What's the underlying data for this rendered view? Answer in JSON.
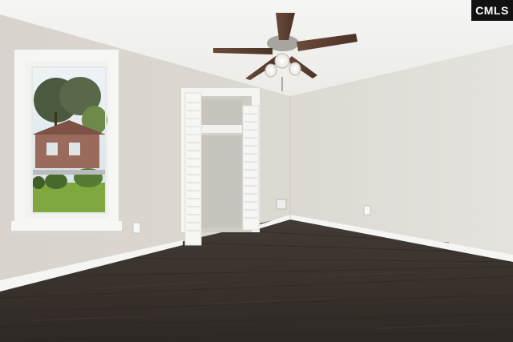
{
  "watermark": {
    "logo_text": "CMLS",
    "bg_color": "#111111",
    "text_color": "#ffffff"
  },
  "colors": {
    "ceiling": "#f3f3f1",
    "wall_left": "#d9d5cf",
    "wall_back": "#dedad4",
    "wall_right": "#e2dfda",
    "floor": "#3b342f",
    "trim": "#f7f7f5"
  }
}
